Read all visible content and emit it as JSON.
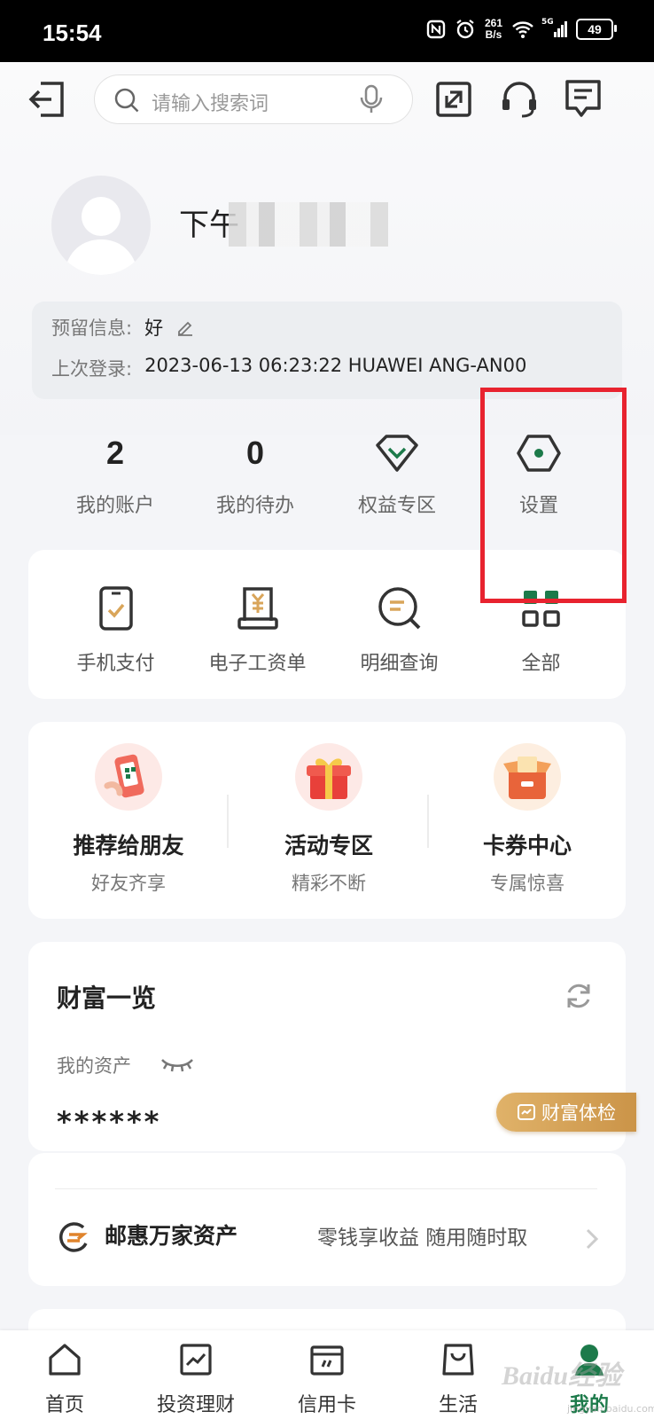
{
  "status_bar": {
    "time": "15:54",
    "net_speed_value": "261",
    "net_speed_unit": "B/s",
    "network": "5G",
    "battery": "49"
  },
  "header": {
    "search_placeholder": "请输入搜索词"
  },
  "profile": {
    "name_visible": "下午"
  },
  "info": {
    "reserved_label": "预留信息:",
    "reserved_value": "好",
    "last_login_label": "上次登录:",
    "last_login_value": "2023-06-13 06:23:22 HUAWEI ANG-AN00"
  },
  "stats": [
    {
      "value": "2",
      "label": "我的账户"
    },
    {
      "value": "0",
      "label": "我的待办"
    },
    {
      "label": "权益专区",
      "icon": "diamond-icon"
    },
    {
      "label": "设置",
      "icon": "settings-hexagon-icon"
    }
  ],
  "quick_actions": [
    {
      "label": "手机支付",
      "icon": "phone-pay-icon"
    },
    {
      "label": "电子工资单",
      "icon": "payslip-icon"
    },
    {
      "label": "明细查询",
      "icon": "detail-search-icon"
    },
    {
      "label": "全部",
      "icon": "grid-icon"
    }
  ],
  "promos": [
    {
      "title": "推荐给朋友",
      "subtitle": "好友齐享",
      "icon": "phone-qr-icon"
    },
    {
      "title": "活动专区",
      "subtitle": "精彩不断",
      "icon": "gift-box-icon"
    },
    {
      "title": "卡券中心",
      "subtitle": "专属惊喜",
      "icon": "coupon-box-icon"
    }
  ],
  "wealth": {
    "title": "财富一览",
    "assets_label": "我的资产",
    "assets_value": "******",
    "checkup_label": "财富体检"
  },
  "youhui": {
    "title": "邮惠万家资产",
    "desc": "零钱享收益 随用随时取"
  },
  "tabbar": [
    {
      "label": "首页",
      "icon": "home-icon"
    },
    {
      "label": "投资理财",
      "icon": "chart-icon"
    },
    {
      "label": "信用卡",
      "icon": "credit-card-icon"
    },
    {
      "label": "生活",
      "icon": "shopping-bag-icon"
    },
    {
      "label": "我的",
      "icon": "user-icon",
      "active": true
    }
  ],
  "watermark": {
    "brand": "Baidu经验",
    "url": "jingyan.baidu.com"
  },
  "colors": {
    "accent_green": "#1c7a4a",
    "highlight_red": "#e8232f",
    "gold": "#d9a55a"
  }
}
